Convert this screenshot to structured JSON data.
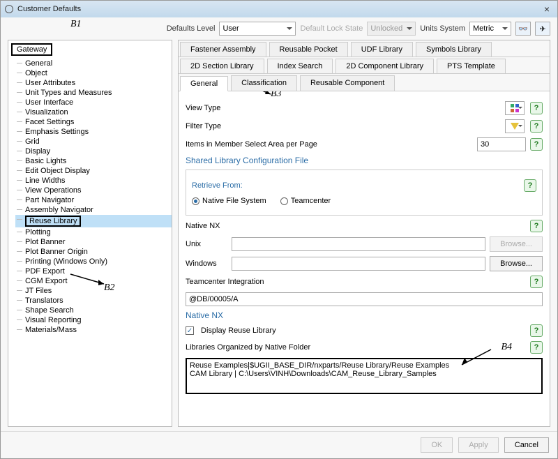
{
  "window": {
    "title": "Customer Defaults"
  },
  "annotations": {
    "b1": "B1",
    "b2": "B2",
    "b3": "B3",
    "b4": "B4"
  },
  "toolbar": {
    "defaults_level_label": "Defaults Level",
    "defaults_level_value": "User",
    "lock_state_label": "Default Lock State",
    "lock_state_value": "Unlocked",
    "units_label": "Units System",
    "units_value": "Metric"
  },
  "tree": {
    "root": "Gateway",
    "items": [
      "General",
      "Object",
      "User Attributes",
      "Unit Types and Measures",
      "User Interface",
      "Visualization",
      "Facet Settings",
      "Emphasis Settings",
      "Grid",
      "Display",
      "Basic Lights",
      "Edit Object Display",
      "Line Widths",
      "View Operations",
      "Part Navigator",
      "Assembly Navigator",
      "Reuse Library",
      "Plotting",
      "Plot Banner",
      "Plot Banner Origin",
      "Printing (Windows Only)",
      "PDF Export",
      "CGM Export",
      "JT Files",
      "Translators",
      "Shape Search",
      "Visual Reporting",
      "Materials/Mass"
    ],
    "selected_index": 16
  },
  "tabs_row1": [
    "Fastener Assembly",
    "Reusable Pocket",
    "UDF Library",
    "Symbols Library"
  ],
  "tabs_row2": [
    "2D Section Library",
    "Index Search",
    "2D Component Library",
    "PTS Template"
  ],
  "tabs_row3": [
    "General",
    "Classification",
    "Reusable Component"
  ],
  "tabs_row3_active": 0,
  "general": {
    "view_type_label": "View Type",
    "filter_type_label": "Filter Type",
    "items_per_page_label": "Items in Member Select Area per Page",
    "items_per_page_value": "30",
    "shared_lib_title": "Shared Library Configuration File",
    "retrieve_from_label": "Retrieve From:",
    "retrieve_opts": [
      "Native File System",
      "Teamcenter"
    ],
    "retrieve_selected": 0,
    "native_nx_label": "Native NX",
    "unix_label": "Unix",
    "windows_label": "Windows",
    "browse_label": "Browse...",
    "tc_integration_label": "Teamcenter Integration",
    "tc_integration_value": "@DB/00005/A",
    "native_nx_section": "Native NX",
    "display_reuse_label": "Display Reuse Library",
    "display_reuse_checked": true,
    "libs_by_folder_label": "Libraries Organized by Native Folder",
    "libs_by_folder_value": "Reuse Examples|$UGII_BASE_DIR/nxparts/Reuse Library/Reuse Examples\nCAM Library | C:\\Users\\VINH\\Downloads\\CAM_Reuse_Library_Samples"
  },
  "footer": {
    "ok": "OK",
    "apply": "Apply",
    "cancel": "Cancel"
  }
}
